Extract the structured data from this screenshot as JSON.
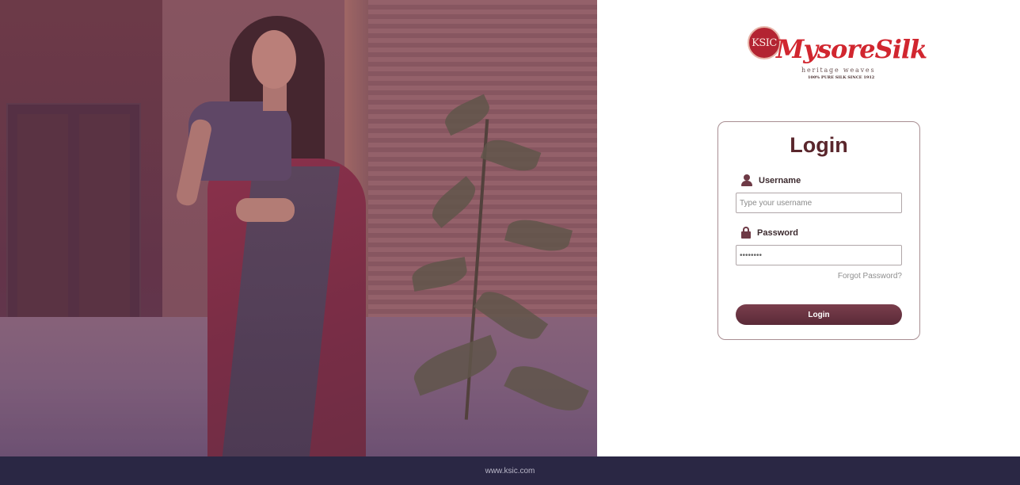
{
  "hero": {
    "image_name": "hero-saree-model"
  },
  "logo": {
    "emblem_text": "KSIC",
    "brand": "MysoreSilk",
    "tagline": "heritage weaves",
    "since": "100% PURE SILK SINCE 1912"
  },
  "login": {
    "title": "Login",
    "username_label": "Username",
    "username_placeholder": "Type your username",
    "username_value": "",
    "password_label": "Password",
    "password_value": "********",
    "forgot_label": "Forgot Password?",
    "submit_label": "Login"
  },
  "footer": {
    "text": "www.ksic.com"
  },
  "colors": {
    "accent": "#5a262c",
    "button": "#6a3442",
    "brand_red": "#d1262f",
    "footer_bg": "#2a2744"
  },
  "icons": {
    "username": "user-icon",
    "password": "lock-icon"
  }
}
